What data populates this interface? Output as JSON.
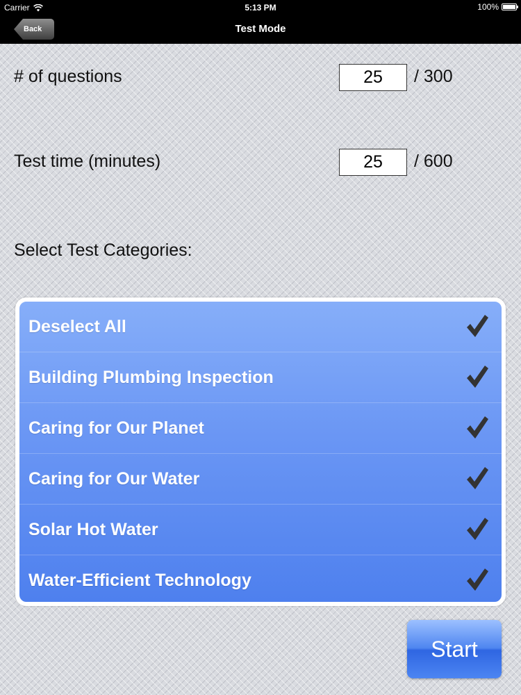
{
  "status_bar": {
    "carrier": "Carrier",
    "time": "5:13 PM",
    "battery": "100%",
    "battery_level": 1.0
  },
  "nav": {
    "back_label": "Back",
    "title": "Test Mode"
  },
  "form": {
    "questions_label": "# of questions",
    "questions_value": "25",
    "questions_max": "/ 300",
    "time_label": "Test time (minutes)",
    "time_value": "25",
    "time_max": "/ 600"
  },
  "categories": {
    "heading": "Select Test Categories:",
    "items": [
      {
        "label": "Deselect All",
        "checked": true
      },
      {
        "label": "Building Plumbing Inspection",
        "checked": true
      },
      {
        "label": "Caring for Our Planet",
        "checked": true
      },
      {
        "label": "Caring for Our Water",
        "checked": true
      },
      {
        "label": "Solar Hot Water",
        "checked": true
      },
      {
        "label": "Water-Efficient Technology",
        "checked": true
      }
    ]
  },
  "actions": {
    "start_label": "Start"
  },
  "colors": {
    "list_top": "#86aef9",
    "list_bottom": "#4e80ee",
    "checkmark": "#333333",
    "nav_background": "#000000"
  },
  "icons": {
    "wifi": "wifi-icon",
    "battery": "battery-icon",
    "check": "checkmark-icon"
  }
}
